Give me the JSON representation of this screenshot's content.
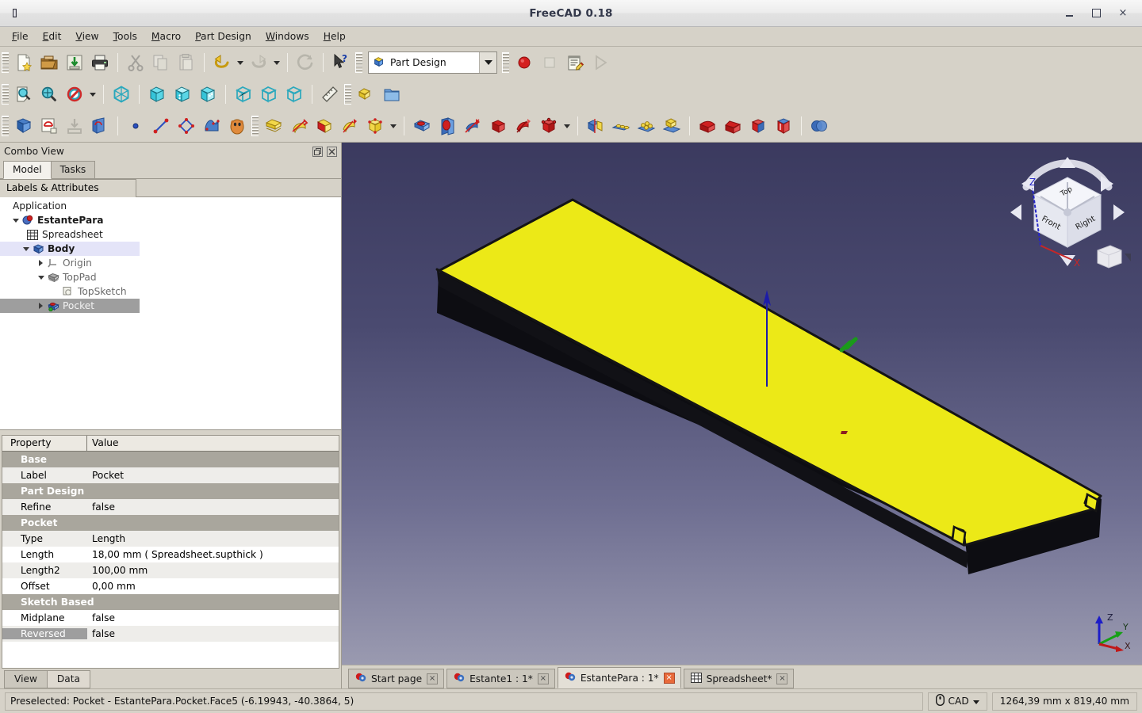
{
  "window": {
    "title": "FreeCAD 0.18",
    "app_icon": "freecad-icon",
    "minimize": "minimize-button",
    "maximize": "maximize-button",
    "close": "×"
  },
  "menubar": {
    "items": [
      {
        "label": "File",
        "mnemonic": "F"
      },
      {
        "label": "Edit",
        "mnemonic": "E"
      },
      {
        "label": "View",
        "mnemonic": "V"
      },
      {
        "label": "Tools",
        "mnemonic": "T"
      },
      {
        "label": "Macro",
        "mnemonic": "M"
      },
      {
        "label": "Part Design",
        "mnemonic": "P"
      },
      {
        "label": "Windows",
        "mnemonic": "W"
      },
      {
        "label": "Help",
        "mnemonic": "H"
      }
    ]
  },
  "toolbars": {
    "file": [
      "new-document-icon",
      "open-document-icon",
      "save-document-icon",
      "print-icon",
      "cut-icon",
      "copy-icon",
      "paste-icon",
      "undo-icon",
      "redo-icon",
      "refresh-icon",
      "whats-this-icon"
    ],
    "workbench": {
      "selected": "Part Design",
      "icon": "part-design-workbench-icon"
    },
    "macro": [
      "macro-record-icon",
      "macro-stop-icon",
      "macro-edit-icon",
      "macro-execute-icon"
    ],
    "view": [
      "fit-all-icon",
      "fit-selection-icon",
      "draw-style-icon",
      "isometric-view-icon",
      "front-view-icon",
      "top-view-icon",
      "right-view-icon",
      "rear-view-icon",
      "bottom-view-icon",
      "left-view-icon",
      "measure-icon",
      "part-icon",
      "group-icon"
    ],
    "partdesign": [
      "create-body-icon",
      "create-sketch-icon",
      "attach-sketch-icon",
      "edit-sketch-icon",
      "create-point-icon",
      "create-line-icon",
      "create-polyline-icon",
      "create-bspline-icon",
      "create-shape-binder-icon",
      "pad-icon",
      "revolution-icon",
      "additive-loft-icon",
      "additive-pipe-icon",
      "additive-primitive-icon",
      "pocket-icon",
      "hole-icon",
      "groove-icon",
      "subtractive-loft-icon",
      "subtractive-pipe-icon",
      "subtractive-primitive-icon",
      "mirrored-icon",
      "linear-pattern-icon",
      "polar-pattern-icon",
      "multi-transform-icon",
      "fillet-icon",
      "chamfer-icon",
      "draft-icon",
      "thickness-icon",
      "boolean-icon"
    ]
  },
  "combo_view": {
    "title": "Combo View",
    "float_button": "float-panel-button",
    "close_button": "close-panel-button",
    "tabs": [
      {
        "label": "Model",
        "active": true
      },
      {
        "label": "Tasks",
        "active": false
      }
    ],
    "section_header": "Labels & Attributes",
    "tree": [
      {
        "label": "Application",
        "indent": 0,
        "arrow": "none",
        "icon": "none",
        "bold": false,
        "dim": false,
        "select": "none"
      },
      {
        "label": "EstantePara",
        "indent": 1,
        "arrow": "down",
        "icon": "document-icon",
        "bold": true,
        "dim": false,
        "select": "none"
      },
      {
        "label": "Spreadsheet",
        "indent": 2,
        "arrow": "none",
        "icon": "spreadsheet-icon",
        "bold": false,
        "dim": false,
        "select": "none"
      },
      {
        "label": "Body",
        "indent": 2,
        "arrow": "down",
        "icon": "body-icon",
        "bold": true,
        "dim": false,
        "select": "soft"
      },
      {
        "label": "Origin",
        "indent": 3,
        "arrow": "right",
        "icon": "origin-icon",
        "bold": false,
        "dim": true,
        "select": "none"
      },
      {
        "label": "TopPad",
        "indent": 3,
        "arrow": "down",
        "icon": "pad-icon",
        "bold": false,
        "dim": true,
        "select": "none"
      },
      {
        "label": "TopSketch",
        "indent": 4,
        "arrow": "none",
        "icon": "sketch-icon",
        "bold": false,
        "dim": true,
        "select": "none"
      },
      {
        "label": "Pocket",
        "indent": 3,
        "arrow": "right",
        "icon": "pocket-icon",
        "bold": false,
        "dim": true,
        "select": "hard"
      }
    ]
  },
  "properties": {
    "header": {
      "property": "Property",
      "value": "Value"
    },
    "rows": [
      {
        "kind": "group",
        "name": "Base",
        "value": ""
      },
      {
        "kind": "item",
        "name": "Label",
        "value": "Pocket",
        "shade": "alt"
      },
      {
        "kind": "group",
        "name": "Part Design",
        "value": ""
      },
      {
        "kind": "item",
        "name": "Refine",
        "value": "false",
        "shade": "alt"
      },
      {
        "kind": "group",
        "name": "Pocket",
        "value": ""
      },
      {
        "kind": "item",
        "name": "Type",
        "value": "Length",
        "shade": "alt"
      },
      {
        "kind": "item",
        "name": "Length",
        "value": "18,00 mm  ( Spreadsheet.supthick )",
        "shade": "white"
      },
      {
        "kind": "item",
        "name": "Length2",
        "value": "100,00 mm",
        "shade": "alt"
      },
      {
        "kind": "item",
        "name": "Offset",
        "value": "0,00 mm",
        "shade": "white"
      },
      {
        "kind": "group",
        "name": "Sketch Based",
        "value": ""
      },
      {
        "kind": "item",
        "name": "Midplane",
        "value": "false",
        "shade": "white"
      },
      {
        "kind": "item",
        "name": "Reversed",
        "value": "false",
        "shade": "alt",
        "highlight": true
      }
    ],
    "tabs": [
      {
        "label": "View",
        "active": false
      },
      {
        "label": "Data",
        "active": true
      }
    ]
  },
  "view3d": {
    "navcube": {
      "top_face": "Top",
      "front_face": "Front",
      "right_face": "Right",
      "axis_z": "Z",
      "axis_x": "X",
      "corner_cube": "corner-cube-icon"
    },
    "axis_cross": {
      "x": "X",
      "y": "Y",
      "z": "Z"
    },
    "model_color": "#ece917",
    "background_top": "#3b3a5f",
    "background_bottom": "#9a9ab0"
  },
  "document_tabs": [
    {
      "label": "Start page",
      "icon": "freecad-doc-icon",
      "active": false,
      "close": "×"
    },
    {
      "label": "Estante1 : 1*",
      "icon": "freecad-doc-icon",
      "active": false,
      "close": "×"
    },
    {
      "label": "EstantePara : 1*",
      "icon": "freecad-doc-icon",
      "active": true,
      "close": "×"
    },
    {
      "label": "Spreadsheet*",
      "icon": "spreadsheet-icon",
      "active": false,
      "close": "×"
    }
  ],
  "statusbar": {
    "message": "Preselected: Pocket - EstantePara.Pocket.Face5 (-6.19943, -40.3864, 5)",
    "nav_mode": "CAD",
    "nav_icon": "mouse-icon",
    "dimensions": "1264,39 mm x 819,40 mm"
  }
}
